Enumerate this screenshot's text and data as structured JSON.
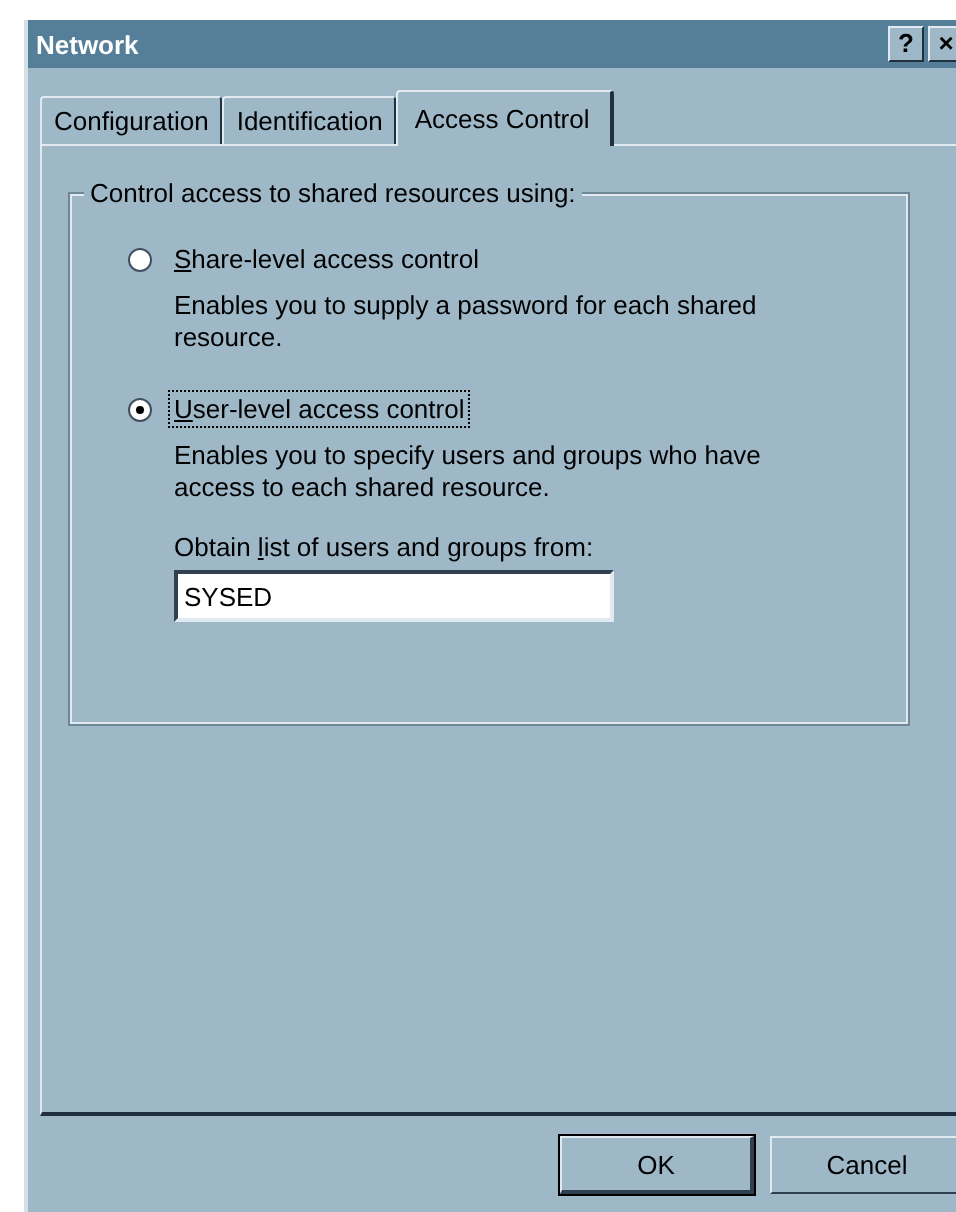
{
  "window": {
    "title": "Network",
    "help_button": "?",
    "close_button": "×"
  },
  "tabs": [
    {
      "label": "Configuration",
      "selected": false
    },
    {
      "label": "Identification",
      "selected": false
    },
    {
      "label": "Access Control",
      "selected": true
    }
  ],
  "group": {
    "title": "Control access to shared resources using:",
    "options": [
      {
        "label": "Share-level access control",
        "selected": false,
        "focused": false,
        "description": "Enables you to supply a password for each shared resource."
      },
      {
        "label": "User-level access control",
        "selected": true,
        "focused": true,
        "description": "Enables you to specify users and groups who have access to each shared resource."
      }
    ],
    "source": {
      "label": "Obtain list of users and groups from:",
      "value": "SYSED"
    }
  },
  "buttons": [
    {
      "label": "OK",
      "default": true
    },
    {
      "label": "Cancel",
      "default": false
    }
  ]
}
